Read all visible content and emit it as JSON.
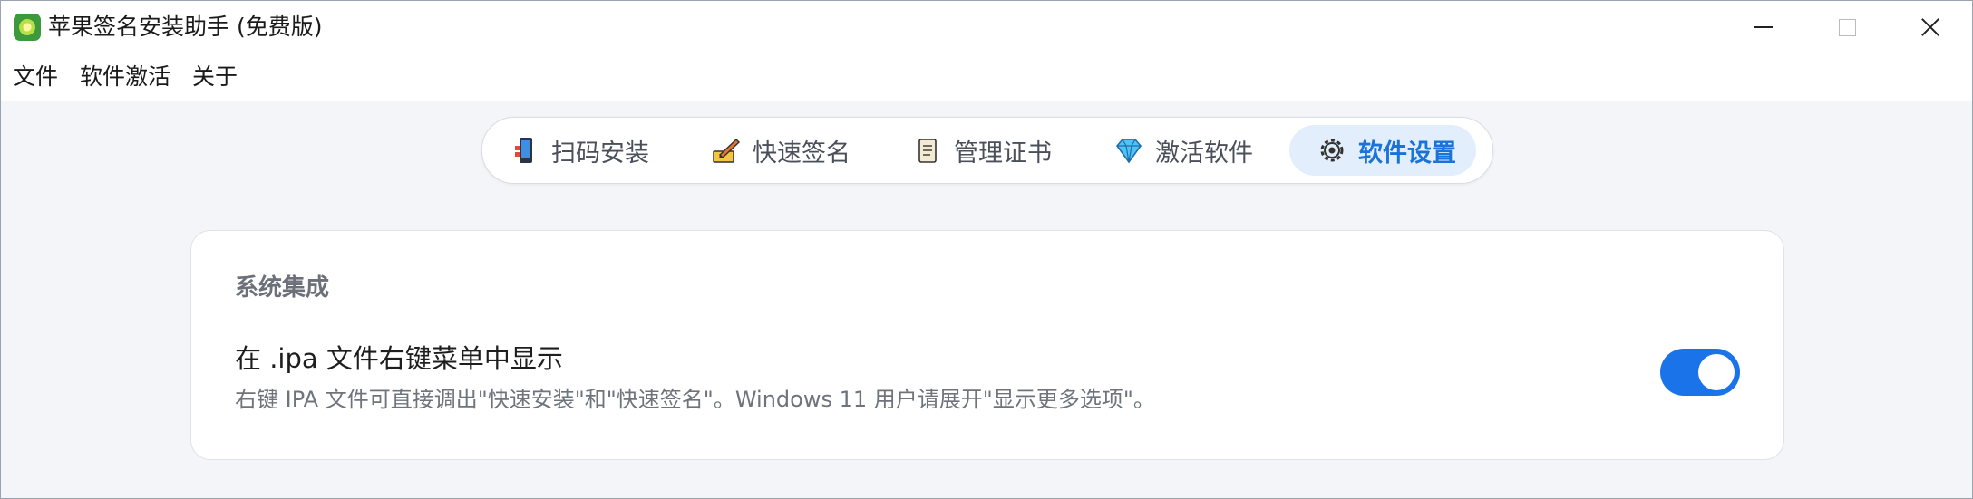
{
  "window": {
    "title": "苹果签名安装助手 (免费版)",
    "icon": "app-logo-icon"
  },
  "menu": {
    "items": [
      "文件",
      "软件激活",
      "关于"
    ]
  },
  "tabs": [
    {
      "label": "扫码安装",
      "icon": "phone-icon",
      "active": false
    },
    {
      "label": "快速签名",
      "icon": "pen-sign-icon",
      "active": false
    },
    {
      "label": "管理证书",
      "icon": "scroll-icon",
      "active": false
    },
    {
      "label": "激活软件",
      "icon": "diamond-icon",
      "active": false
    },
    {
      "label": "软件设置",
      "icon": "gear-icon",
      "active": true
    }
  ],
  "settings": {
    "section_title": "系统集成",
    "option": {
      "title": "在 .ipa 文件右键菜单中显示",
      "description": "右键 IPA 文件可直接调出\"快速安装\"和\"快速签名\"。Windows 11 用户请展开\"显示更多选项\"。",
      "enabled": true
    }
  },
  "colors": {
    "accent": "#1a73e8",
    "active_tab_bg": "#e3eefc",
    "background": "#f4f5f9"
  }
}
